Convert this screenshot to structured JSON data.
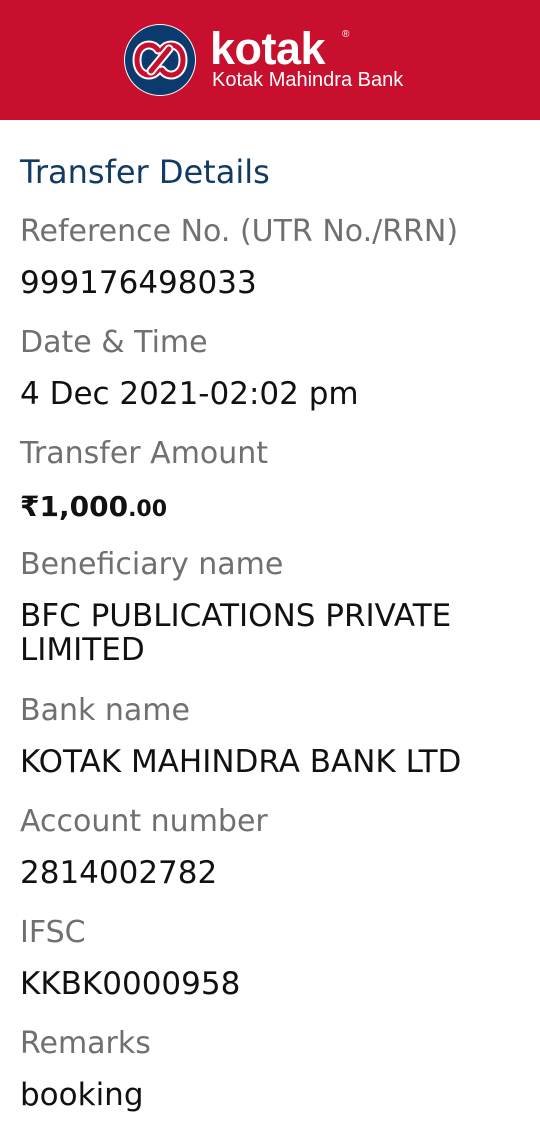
{
  "header": {
    "brand": "kotak",
    "registered": "®",
    "subtitle": "Kotak Mahindra Bank",
    "logo_icon": "kotak-infinity-logo",
    "colors": {
      "background": "#c8102e",
      "logo_blue": "#0a3a6e",
      "logo_red": "#c8102e"
    }
  },
  "section_title": "Transfer Details",
  "fields": {
    "reference": {
      "label": "Reference No. (UTR No./RRN)",
      "value": "999176498033"
    },
    "date_time": {
      "label": "Date & Time",
      "value": "4 Dec 2021-02:02 pm"
    },
    "amount": {
      "label": "Transfer Amount",
      "main": "₹1,000",
      "decimals": ".00"
    },
    "beneficiary": {
      "label": "Beneficiary name",
      "value": "BFC PUBLICATIONS PRIVATE LIMITED"
    },
    "bank": {
      "label": "Bank name",
      "value": "KOTAK MAHINDRA BANK LTD"
    },
    "account": {
      "label": "Account number",
      "value": "2814002782"
    },
    "ifsc": {
      "label": "IFSC",
      "value": "KKBK0000958"
    },
    "remarks": {
      "label": "Remarks",
      "value": "booking"
    }
  }
}
